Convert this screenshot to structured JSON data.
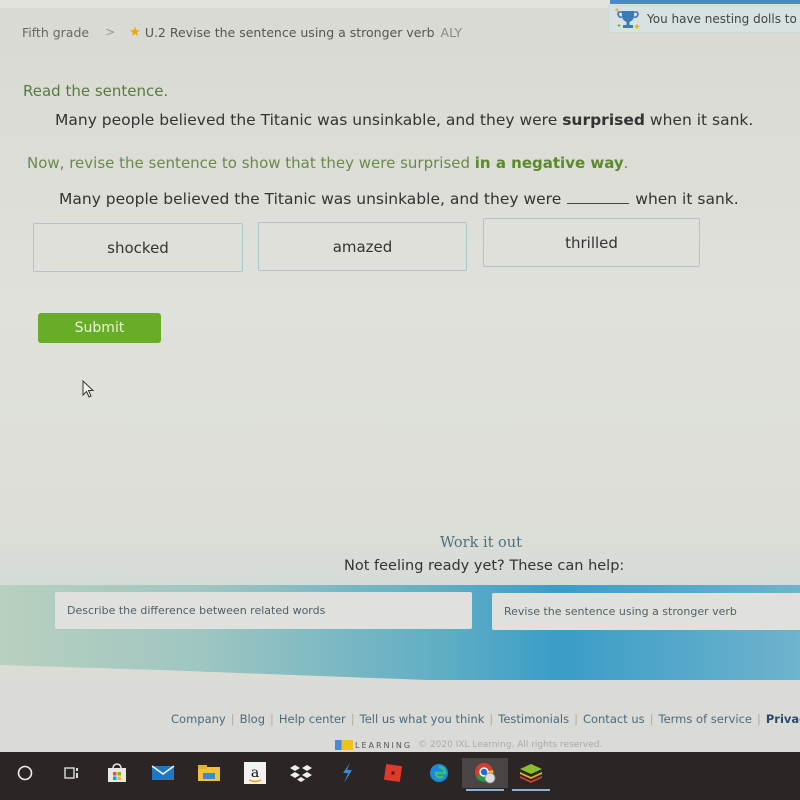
{
  "breadcrumb": {
    "grade": "Fifth grade",
    "separator": ">",
    "skill": "U.2 Revise the sentence using a stronger verb",
    "code": "ALY"
  },
  "notice": {
    "text": "You have nesting dolls to re"
  },
  "question": {
    "read_label": "Read the sentence.",
    "sentence_before": "Many people believed the Titanic was unsinkable, and they were ",
    "sentence_bold": "surprised",
    "sentence_after": " when it sank.",
    "instruction_before": "Now, revise the sentence to show that they were surprised ",
    "instruction_bold": "in a negative way",
    "instruction_after": ".",
    "revised_before": "Many people believed the Titanic was unsinkable, and they were",
    "revised_after": "when it sank.",
    "choices": [
      "shocked",
      "amazed",
      "thrilled"
    ],
    "submit_label": "Submit"
  },
  "work_it_out": {
    "title": "Work it out",
    "subtitle": "Not feeling ready yet? These can help:",
    "links": [
      "Describe the difference between related words",
      "Revise the sentence using a stronger verb"
    ]
  },
  "footer": {
    "links": [
      "Company",
      "Blog",
      "Help center",
      "Tell us what you think",
      "Testimonials",
      "Contact us",
      "Terms of service",
      "Privacy policy"
    ],
    "logo_word": "LEARNING",
    "copyright": "© 2020 IXL Learning. All rights reserved."
  },
  "taskbar": {
    "icons": [
      "cortana-search-icon",
      "task-view-icon",
      "store-icon",
      "mail-icon",
      "file-explorer-icon",
      "amazon-icon",
      "dropbox-icon",
      "app-bolt-icon",
      "roblox-icon",
      "edge-icon",
      "chrome-icon",
      "bluestacks-icon"
    ]
  },
  "colors": {
    "submit": "#67ad27",
    "instruction_green": "#5a8a2a",
    "link_blue": "#4a6a80"
  }
}
